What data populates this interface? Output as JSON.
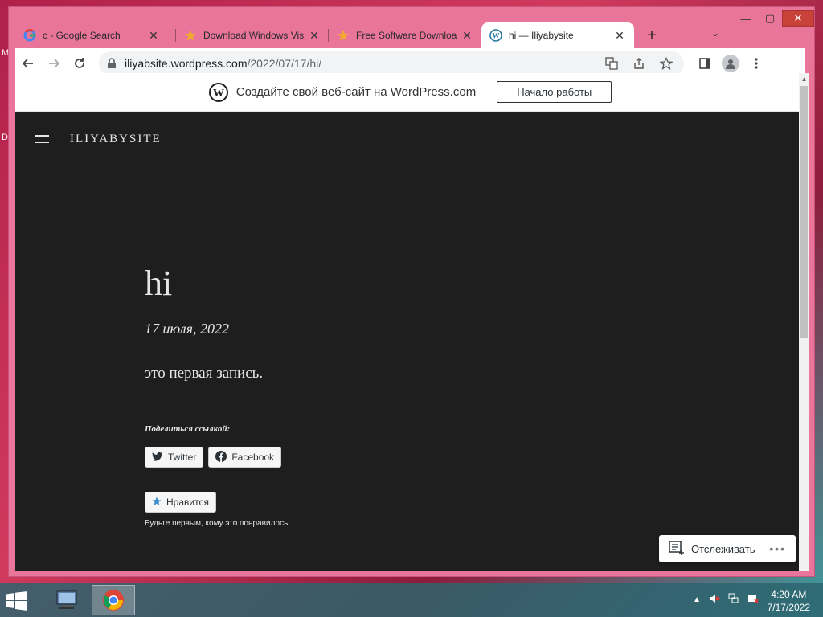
{
  "browser": {
    "tabs": [
      {
        "title": "c - Google Search",
        "favicon": "google-icon",
        "active": false
      },
      {
        "title": "Download Windows Vis",
        "favicon": "star-icon",
        "active": false
      },
      {
        "title": "Free Software Downloa",
        "favicon": "star-icon",
        "active": false
      },
      {
        "title": "hi — Iliyabysite",
        "favicon": "wordpress-icon",
        "active": true
      }
    ],
    "tab_close": "✕",
    "new_tab": "+",
    "url_host": "iliyabsite.wordpress.com",
    "url_path": "/2022/07/17/hi/"
  },
  "wp_banner": {
    "text": "Создайте свой веб-сайт на WordPress.com",
    "button": "Начало работы"
  },
  "site": {
    "title": "ILIYABYSITE"
  },
  "post": {
    "title": "hi",
    "date": "17 июля, 2022",
    "body": "это первая запись.",
    "share_label": "Поделиться ссылкой:",
    "share_buttons": [
      "Twitter",
      "Facebook"
    ],
    "like_button": "Нравится",
    "like_note": "Будьте первым, кому это понравилось."
  },
  "follow": {
    "label": "Отслеживать",
    "more": "•••"
  },
  "taskbar": {
    "time": "4:20 AM",
    "date": "7/17/2022"
  },
  "colors": {
    "page_bg": "#1e1e1e",
    "window_frame": "#e9759a",
    "taskbar": "#2d646e"
  }
}
